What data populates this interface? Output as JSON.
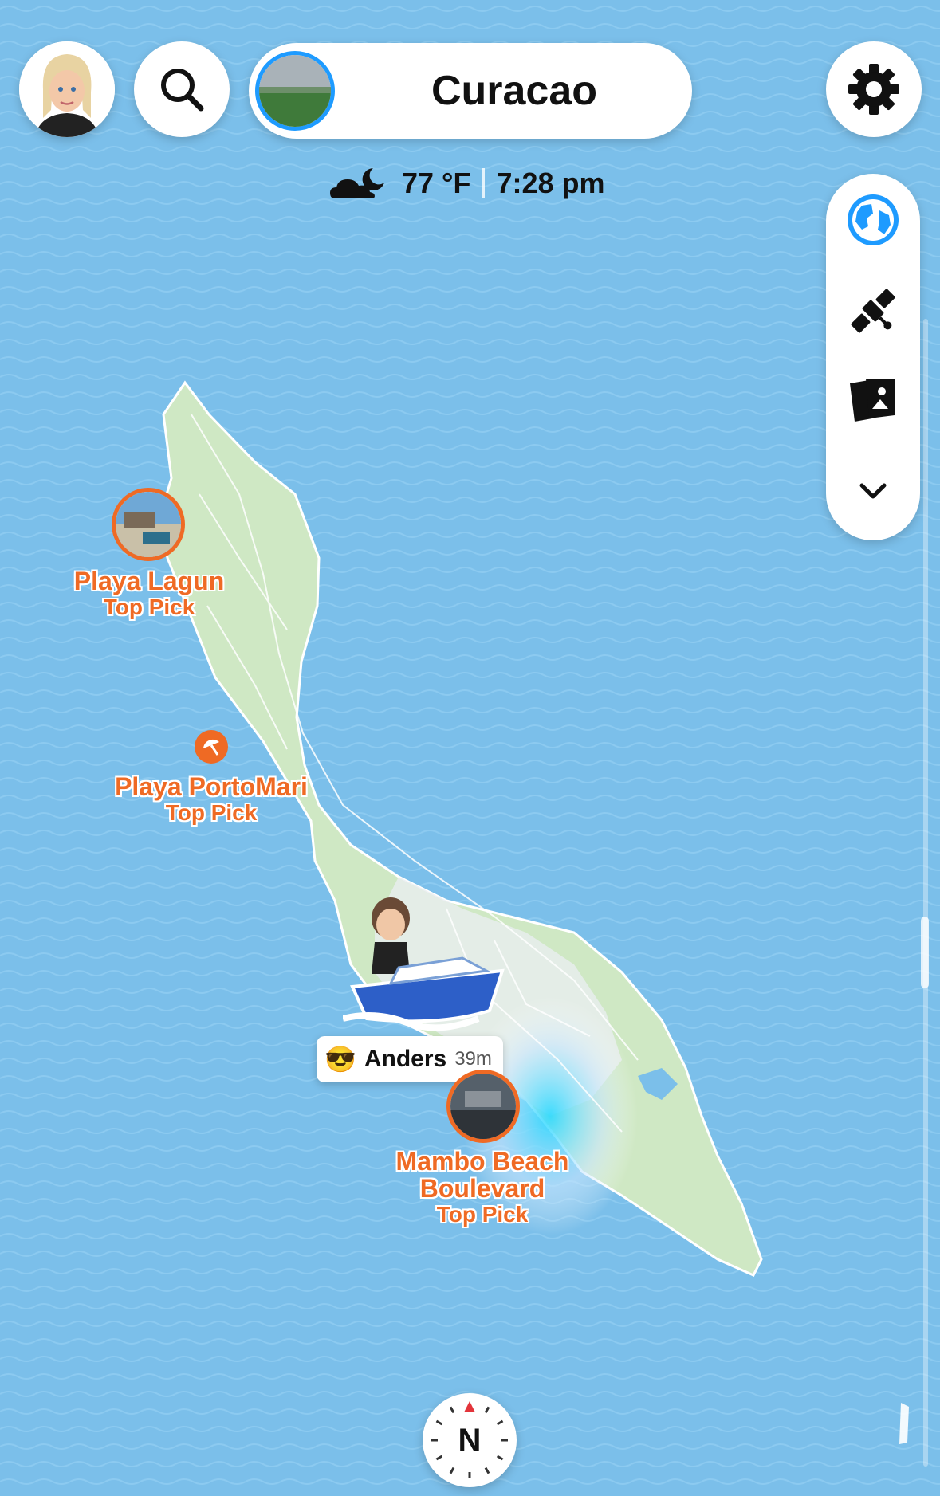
{
  "header": {
    "location_name": "Curacao",
    "avatar_icon": "bitmoji-avatar-icon",
    "search_icon": "search-icon",
    "settings_icon": "gear-icon"
  },
  "weather": {
    "icon": "partly-cloudy-night-icon",
    "temperature": "77 °F",
    "time": "7:28 pm"
  },
  "layers_panel": {
    "items": [
      {
        "icon": "globe-icon",
        "color": "#1e9bff"
      },
      {
        "icon": "satellite-icon"
      },
      {
        "icon": "memories-icon"
      },
      {
        "icon": "chevron-down-icon"
      }
    ]
  },
  "places": [
    {
      "name": "Playa Lagun",
      "tag": "Top Pick"
    },
    {
      "name": "Playa PortoMari",
      "tag": "Top Pick"
    },
    {
      "name_line1": "Mambo Beach",
      "name_line2": "Boulevard",
      "tag": "Top Pick"
    }
  ],
  "friend": {
    "emoji": "😎",
    "name": "Anders",
    "time_ago": "39m"
  },
  "compass": {
    "label": "N"
  },
  "colors": {
    "ocean": "#7bbfea",
    "land": "#cfe8c4",
    "accent": "#ef6a24",
    "selected": "#1e9bff"
  }
}
